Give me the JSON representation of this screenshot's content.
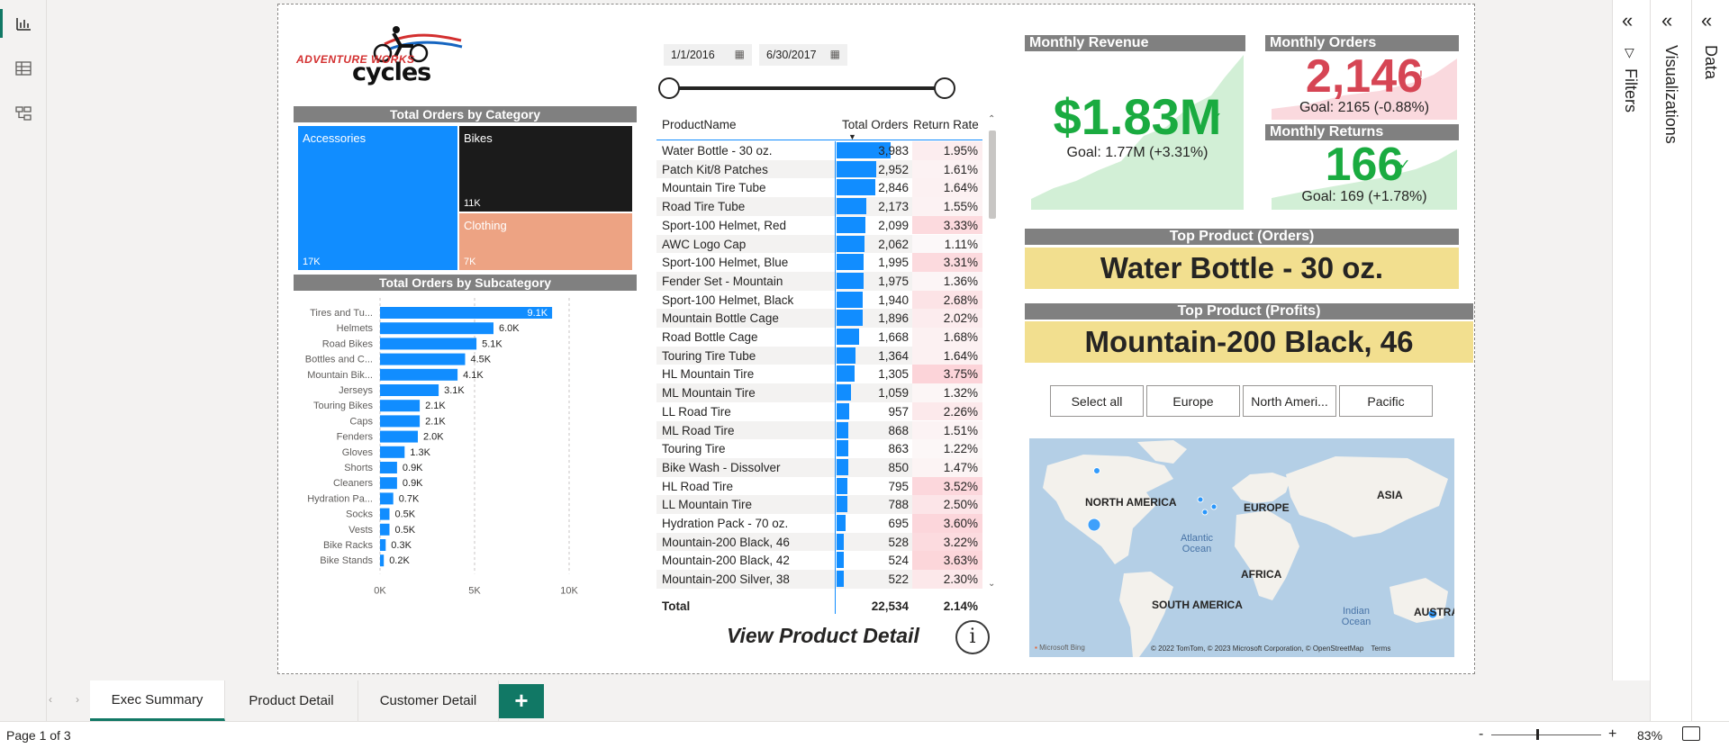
{
  "logo": {
    "line1": "ADVENTURE WORKS",
    "line2": "cycles"
  },
  "date_range": {
    "start": "1/1/2016",
    "end": "6/30/2017"
  },
  "category": {
    "title": "Total Orders by Category",
    "items": [
      {
        "label": "Accessories",
        "value_label": "17K",
        "value": 17000,
        "color": "#118dff"
      },
      {
        "label": "Bikes",
        "value_label": "11K",
        "value": 11000,
        "color": "#1b1b1b"
      },
      {
        "label": "Clothing",
        "value_label": "7K",
        "value": 7000,
        "color": "#eda383"
      }
    ]
  },
  "chart_data": {
    "type": "bar",
    "title": "Total Orders by Subcategory",
    "orientation": "horizontal",
    "categories": [
      "Tires and Tu...",
      "Helmets",
      "Road Bikes",
      "Bottles and C...",
      "Mountain Bik...",
      "Jerseys",
      "Touring Bikes",
      "Caps",
      "Fenders",
      "Gloves",
      "Shorts",
      "Cleaners",
      "Hydration Pa...",
      "Socks",
      "Vests",
      "Bike Racks",
      "Bike Stands"
    ],
    "values": [
      9100,
      6000,
      5100,
      4500,
      4100,
      3100,
      2100,
      2100,
      2000,
      1300,
      900,
      900,
      700,
      500,
      500,
      300,
      200
    ],
    "value_labels": [
      "9.1K",
      "6.0K",
      "5.1K",
      "4.5K",
      "4.1K",
      "3.1K",
      "2.1K",
      "2.1K",
      "2.0K",
      "1.3K",
      "0.9K",
      "0.9K",
      "0.7K",
      "0.5K",
      "0.5K",
      "0.3K",
      "0.2K"
    ],
    "xlim": [
      0,
      10000
    ],
    "x_ticks": [
      "0K",
      "5K",
      "10K"
    ],
    "color": "#118dff",
    "grid": "vertical-dashed"
  },
  "table": {
    "headers": {
      "name": "ProductName",
      "orders": "Total Orders",
      "rate": "Return Rate"
    },
    "max_orders": 3983,
    "rows": [
      {
        "name": "Water Bottle - 30 oz.",
        "orders": "3,983",
        "ordersN": 3983,
        "rate": "1.95%",
        "rateN": 1.95
      },
      {
        "name": "Patch Kit/8 Patches",
        "orders": "2,952",
        "ordersN": 2952,
        "rate": "1.61%",
        "rateN": 1.61
      },
      {
        "name": "Mountain Tire Tube",
        "orders": "2,846",
        "ordersN": 2846,
        "rate": "1.64%",
        "rateN": 1.64
      },
      {
        "name": "Road Tire Tube",
        "orders": "2,173",
        "ordersN": 2173,
        "rate": "1.55%",
        "rateN": 1.55
      },
      {
        "name": "Sport-100 Helmet, Red",
        "orders": "2,099",
        "ordersN": 2099,
        "rate": "3.33%",
        "rateN": 3.33
      },
      {
        "name": "AWC Logo Cap",
        "orders": "2,062",
        "ordersN": 2062,
        "rate": "1.11%",
        "rateN": 1.11
      },
      {
        "name": "Sport-100 Helmet, Blue",
        "orders": "1,995",
        "ordersN": 1995,
        "rate": "3.31%",
        "rateN": 3.31
      },
      {
        "name": "Fender Set - Mountain",
        "orders": "1,975",
        "ordersN": 1975,
        "rate": "1.36%",
        "rateN": 1.36
      },
      {
        "name": "Sport-100 Helmet, Black",
        "orders": "1,940",
        "ordersN": 1940,
        "rate": "2.68%",
        "rateN": 2.68
      },
      {
        "name": "Mountain Bottle Cage",
        "orders": "1,896",
        "ordersN": 1896,
        "rate": "2.02%",
        "rateN": 2.02
      },
      {
        "name": "Road Bottle Cage",
        "orders": "1,668",
        "ordersN": 1668,
        "rate": "1.68%",
        "rateN": 1.68
      },
      {
        "name": "Touring Tire Tube",
        "orders": "1,364",
        "ordersN": 1364,
        "rate": "1.64%",
        "rateN": 1.64
      },
      {
        "name": "HL Mountain Tire",
        "orders": "1,305",
        "ordersN": 1305,
        "rate": "3.75%",
        "rateN": 3.75
      },
      {
        "name": "ML Mountain Tire",
        "orders": "1,059",
        "ordersN": 1059,
        "rate": "1.32%",
        "rateN": 1.32
      },
      {
        "name": "LL Road Tire",
        "orders": "957",
        "ordersN": 957,
        "rate": "2.26%",
        "rateN": 2.26
      },
      {
        "name": "ML Road Tire",
        "orders": "868",
        "ordersN": 868,
        "rate": "1.51%",
        "rateN": 1.51
      },
      {
        "name": "Touring Tire",
        "orders": "863",
        "ordersN": 863,
        "rate": "1.22%",
        "rateN": 1.22
      },
      {
        "name": "Bike Wash - Dissolver",
        "orders": "850",
        "ordersN": 850,
        "rate": "1.47%",
        "rateN": 1.47
      },
      {
        "name": "HL Road Tire",
        "orders": "795",
        "ordersN": 795,
        "rate": "3.52%",
        "rateN": 3.52
      },
      {
        "name": "LL Mountain Tire",
        "orders": "788",
        "ordersN": 788,
        "rate": "2.50%",
        "rateN": 2.5
      },
      {
        "name": "Hydration Pack - 70 oz.",
        "orders": "695",
        "ordersN": 695,
        "rate": "3.60%",
        "rateN": 3.6
      },
      {
        "name": "Mountain-200 Black, 46",
        "orders": "528",
        "ordersN": 528,
        "rate": "3.22%",
        "rateN": 3.22
      },
      {
        "name": "Mountain-200 Black, 42",
        "orders": "524",
        "ordersN": 524,
        "rate": "3.63%",
        "rateN": 3.63
      },
      {
        "name": "Mountain-200 Silver, 38",
        "orders": "522",
        "ordersN": 522,
        "rate": "2.30%",
        "rateN": 2.3
      }
    ],
    "total": {
      "label": "Total",
      "orders": "22,534",
      "rate": "2.14%"
    }
  },
  "view_detail": "View Product Detail",
  "kpis": {
    "revenue": {
      "title": "Monthly Revenue",
      "value": "$1.83M",
      "goal": "Goal: 1.77M (+3.31%)",
      "color": "#1aab40"
    },
    "orders": {
      "title": "Monthly Orders",
      "value": "2,146",
      "goal": "Goal: 2165 (-0.88%)",
      "color": "#d64554"
    },
    "returns": {
      "title": "Monthly Returns",
      "value": "166",
      "goal": "Goal: 169 (+1.78%)",
      "color": "#1aab40"
    }
  },
  "top_orders": {
    "title": "Top Product (Orders)",
    "value": "Water Bottle - 30 oz."
  },
  "top_profits": {
    "title": "Top Product (Profits)",
    "value": "Mountain-200 Black, 46"
  },
  "regions": [
    "Select all",
    "Europe",
    "North Ameri...",
    "Pacific"
  ],
  "map": {
    "labels": {
      "na": "NORTH AMERICA",
      "eu": "EUROPE",
      "asia": "ASIA",
      "atlantic": "Atlantic Ocean",
      "africa": "AFRICA",
      "sa": "SOUTH AMERICA",
      "indian": "Indian Ocean",
      "aus": "AUSTRA"
    },
    "bing": "Microsoft Bing",
    "copyright": "© 2022 TomTom, © 2023 Microsoft Corporation, © OpenStreetMap",
    "terms": "Terms"
  },
  "panes": {
    "filters": "Filters",
    "visualizations": "Visualizations",
    "data": "Data"
  },
  "tabs": [
    {
      "label": "Exec Summary",
      "active": true
    },
    {
      "label": "Product Detail",
      "active": false
    },
    {
      "label": "Customer Detail",
      "active": false
    }
  ],
  "add_tab": "+",
  "status": {
    "page": "Page 1 of 3",
    "zoom": "83%",
    "minus": "-",
    "plus": "+"
  }
}
